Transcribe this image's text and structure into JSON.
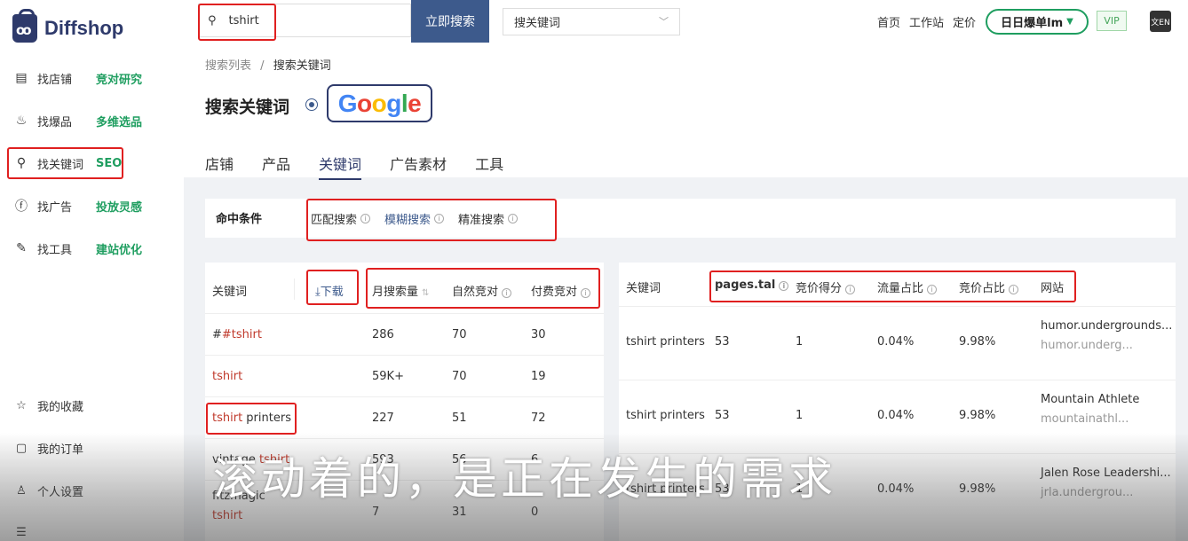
{
  "brand": {
    "name": "Diffshop"
  },
  "sidebar": {
    "items": [
      {
        "label": "找店铺",
        "tag": "竞对研究",
        "icon": "store-icon"
      },
      {
        "label": "找爆品",
        "tag": "多维选品",
        "icon": "fire-icon"
      },
      {
        "label": "找关键词",
        "tag": "SEO",
        "icon": "search-icon"
      },
      {
        "label": "找广告",
        "tag": "投放灵感",
        "icon": "facebook-icon"
      },
      {
        "label": "找工具",
        "tag": "建站优化",
        "icon": "wrench-icon"
      }
    ],
    "bottom": [
      {
        "label": "我的收藏",
        "icon": "star-icon"
      },
      {
        "label": "我的订单",
        "icon": "bag-icon"
      },
      {
        "label": "个人设置",
        "icon": "user-icon"
      }
    ]
  },
  "topbar": {
    "search_value": "tshirt",
    "search_button": "立即搜索",
    "select_value": "搜关键词",
    "links": [
      "首页",
      "工作站",
      "定价"
    ],
    "daily": "日日爆单lm",
    "vip": "VIP",
    "lang_icon": "文EN"
  },
  "page": {
    "breadcrumb": [
      "搜索列表",
      "搜索关键词"
    ],
    "title": "搜索关键词",
    "engine": "Google",
    "tabs": [
      "店铺",
      "产品",
      "关键词",
      "广告素材",
      "工具"
    ]
  },
  "filter": {
    "label": "命中条件",
    "options": [
      "匹配搜索",
      "模糊搜索",
      "精准搜索"
    ]
  },
  "left_table": {
    "headers": {
      "keyword": "关键词",
      "download": "下载",
      "volume": "月搜索量",
      "organic": "自然竞对",
      "paid": "付费竞对"
    },
    "rows": [
      {
        "kw_a": "#tshirt",
        "kw_b": "",
        "volume": "286",
        "organic": "70",
        "paid": "30"
      },
      {
        "kw_a": "tshirt",
        "kw_b": "",
        "volume": "59K+",
        "organic": "70",
        "paid": "19"
      },
      {
        "kw_a": "tshirt",
        "kw_b": " printers",
        "volume": "227",
        "organic": "51",
        "paid": "72"
      },
      {
        "kw_a": "vintage ",
        "kw_b": "tshirt",
        "volume": "593",
        "organic": "56",
        "paid": "6"
      },
      {
        "kw_a": "fitzmagic",
        "kw_b": "tshirt",
        "volume": "7",
        "organic": "31",
        "paid": "0"
      }
    ]
  },
  "right_table": {
    "headers": {
      "keyword": "关键词",
      "pages": "pages.tal",
      "bid_score": "竞价得分",
      "traffic": "流量占比",
      "bid_share": "竞价占比",
      "site": "网站"
    },
    "rows": [
      {
        "keyword": "tshirt printers",
        "pages": "53",
        "bid_score": "1",
        "traffic": "0.04%",
        "bid_share": "9.98%",
        "site_title": "humor.undergrounds...",
        "site_url": "humor.underg..."
      },
      {
        "keyword": "tshirt printers",
        "pages": "53",
        "bid_score": "1",
        "traffic": "0.04%",
        "bid_share": "9.98%",
        "site_title": "Mountain Athlete",
        "site_url": "mountainathl..."
      },
      {
        "keyword": "tshirt printers",
        "pages": "53",
        "bid_score": "1",
        "traffic": "0.04%",
        "bid_share": "9.98%",
        "site_title": "Jalen Rose Leadershi...",
        "site_url": "jrla.undergrou..."
      }
    ]
  },
  "subtitle": "滚动着的，是正在发生的需求",
  "colors": {
    "accent": "#2e3a6b",
    "green": "#1f9e60",
    "highlight": "#e02020",
    "keyword_red": "#c0392b"
  }
}
